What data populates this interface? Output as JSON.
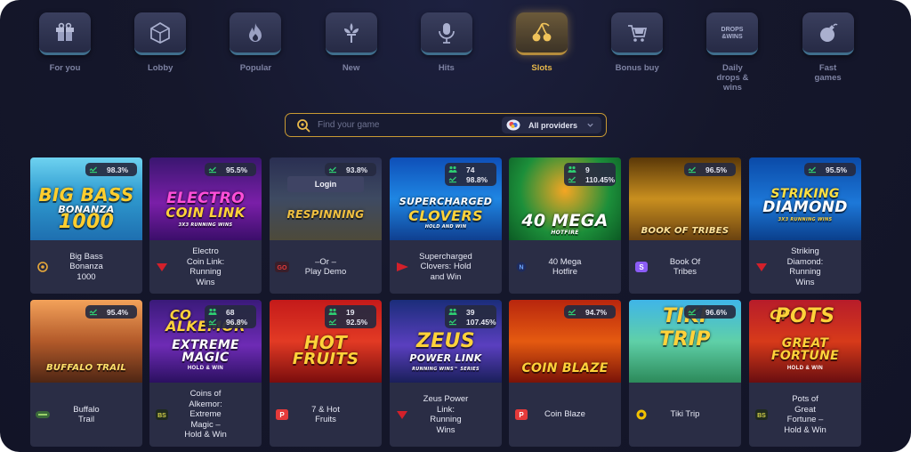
{
  "categories": [
    {
      "label": "For you",
      "icon": "gift-icon",
      "active": false
    },
    {
      "label": "Lobby",
      "icon": "dice-icon",
      "active": false
    },
    {
      "label": "Popular",
      "icon": "flame-icon",
      "active": false
    },
    {
      "label": "New",
      "icon": "fleur-icon",
      "active": false
    },
    {
      "label": "Hits",
      "icon": "microphone-icon",
      "active": false
    },
    {
      "label": "Slots",
      "icon": "cherries-icon",
      "active": true
    },
    {
      "label": "Bonus buy",
      "icon": "cart-icon",
      "active": false
    },
    {
      "label": "Daily\ndrops &\nwins",
      "icon": "drops-wins-icon",
      "active": false
    },
    {
      "label": "Fast\ngames",
      "icon": "bomb-icon",
      "active": false
    }
  ],
  "search": {
    "placeholder": "Find your game",
    "providers_label": "All providers"
  },
  "colors": {
    "accent": "#e8b94a",
    "background": "#15172b",
    "card": "#2a2d45"
  },
  "games": [
    {
      "name": "Big Bass\nBonanza\n1000",
      "thumb": "BIG BASS",
      "thumb_line2": "BONANZA",
      "thumb_line3": "1000",
      "rtp": "98.3%",
      "players": null,
      "provider_icon": "pragmatic-icon"
    },
    {
      "name": "Electro\nCoin Link:\nRunning\nWins",
      "thumb": "ELECTRO",
      "thumb_line2": "COIN LINK",
      "thumb_line3": "3X3 RUNNING WINS",
      "rtp": "95.5%",
      "players": null,
      "provider_icon": "playson-icon"
    },
    {
      "name": "–Or –\nPlay Demo",
      "thumb": "RESPINNING",
      "thumb_line2": "",
      "thumb_line3": "",
      "rtp": "93.8%",
      "players": null,
      "provider_icon": "go-icon",
      "login": "Login"
    },
    {
      "name": "Supercharged\nClovers: Hold\nand Win",
      "thumb": "SUPERCHARGED",
      "thumb_line2": "CLOVERS",
      "thumb_line3": "HOLD AND WIN",
      "rtp": "98.8%",
      "players": "74",
      "provider_icon": "playtech-icon"
    },
    {
      "name": "40 Mega\nHotfire",
      "thumb": "40 MEGA",
      "thumb_line2": "HOTFIRE",
      "thumb_line3": "",
      "rtp": "110.45%",
      "players": "9",
      "provider_icon": "n-provider-icon"
    },
    {
      "name": "Book Of\nTribes",
      "thumb": "BOOK OF TRIBES",
      "thumb_line2": "",
      "thumb_line3": "",
      "rtp": "96.5%",
      "players": null,
      "provider_icon": "s-provider-icon"
    },
    {
      "name": "Striking\nDiamond:\nRunning\nWins",
      "thumb": "STRIKING",
      "thumb_line2": "DIAMOND",
      "thumb_line3": "3X3 RUNNING WINS",
      "rtp": "95.5%",
      "players": null,
      "provider_icon": "playson-icon"
    },
    {
      "name": "Buffalo\nTrail",
      "thumb": "BUFFALO TRAIL",
      "thumb_line2": "",
      "thumb_line3": "",
      "rtp": "95.4%",
      "players": null,
      "provider_icon": "green-provider-icon"
    },
    {
      "name": "Coins of\nAlkemor:\nExtreme\nMagic –\nHold & Win",
      "thumb": "ALKEMOR",
      "thumb_line2": "EXTREME",
      "thumb_line3": "MAGIC",
      "thumb_line4": "HOLD & WIN",
      "thumb_line5": "CO",
      "rtp": "96.8%",
      "players": "68",
      "provider_icon": "bs-provider-icon"
    },
    {
      "name": "7 & Hot\nFruits",
      "thumb": "HOT",
      "thumb_line2": "FRUITS",
      "thumb_line3": "",
      "rtp": "92.5%",
      "players": "19",
      "provider_icon": "p-provider-icon"
    },
    {
      "name": "Zeus Power\nLink:\nRunning\nWins",
      "thumb": "ZEUS",
      "thumb_line2": "POWER LINK",
      "thumb_line3": "RUNNING WINS™ SERIES",
      "rtp": "107.45%",
      "players": "39",
      "provider_icon": "playson-icon"
    },
    {
      "name": "Coin Blaze",
      "thumb": "COIN BLAZE",
      "thumb_line2": "",
      "thumb_line3": "",
      "rtp": "94.7%",
      "players": null,
      "provider_icon": "p-provider-icon"
    },
    {
      "name": "Tiki Trip",
      "thumb": "TIKI",
      "thumb_line2": "TRIP",
      "thumb_line3": "",
      "rtp": "96.6%",
      "players": null,
      "provider_icon": "yellow-provider-icon"
    },
    {
      "name": "Pots of\nGreat\nFortune –\nHold & Win",
      "thumb": "POTS",
      "thumb_line2": "GREAT",
      "thumb_line3": "FORTUNE",
      "thumb_line4": "HOLD & WIN",
      "thumb_line5": "OF",
      "rtp": null,
      "players": null,
      "provider_icon": "bs-provider-icon"
    }
  ]
}
